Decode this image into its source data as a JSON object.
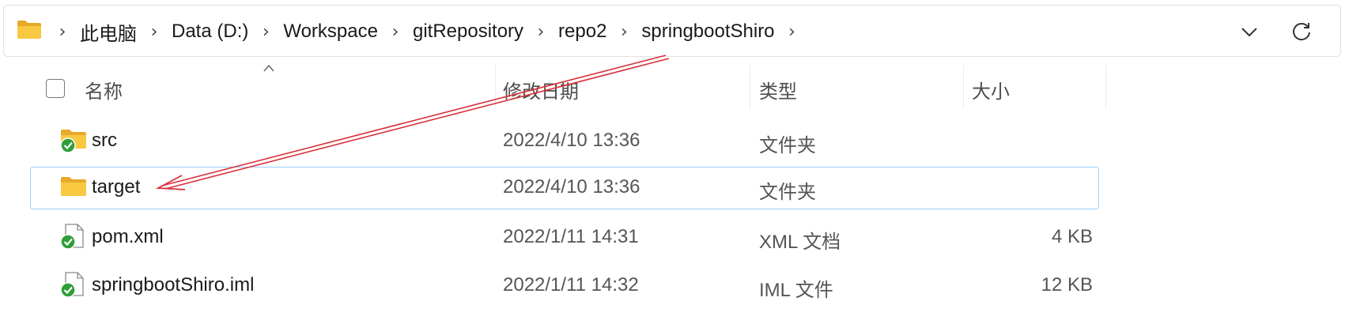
{
  "address_bar": {
    "breadcrumbs": [
      "此电脑",
      "Data (D:)",
      "Workspace",
      "gitRepository",
      "repo2",
      "springbootShiro"
    ],
    "separator": "›",
    "folder_icon": "folder-icon",
    "dropdown_icon": "chevron-down-icon",
    "refresh_icon": "refresh-icon"
  },
  "columns": {
    "name": "名称",
    "modified": "修改日期",
    "type": "类型",
    "size": "大小"
  },
  "files": [
    {
      "name": "src",
      "modified": "2022/4/10 13:36",
      "type": "文件夹",
      "size": "",
      "icon": "folder-synced-icon",
      "selected": false
    },
    {
      "name": "target",
      "modified": "2022/4/10 13:36",
      "type": "文件夹",
      "size": "",
      "icon": "folder-icon",
      "selected": true
    },
    {
      "name": "pom.xml",
      "modified": "2022/1/11 14:31",
      "type": "XML 文档",
      "size": "4 KB",
      "icon": "file-synced-icon",
      "selected": false
    },
    {
      "name": "springbootShiro.iml",
      "modified": "2022/1/11 14:32",
      "type": "IML 文件",
      "size": "12 KB",
      "icon": "file-synced-icon",
      "selected": false
    }
  ],
  "colors": {
    "folder": "#f8c841",
    "sync_badge": "#2e9e3a",
    "selection_border": "#99d1ff",
    "annotation_arrow": "#d9303a"
  }
}
